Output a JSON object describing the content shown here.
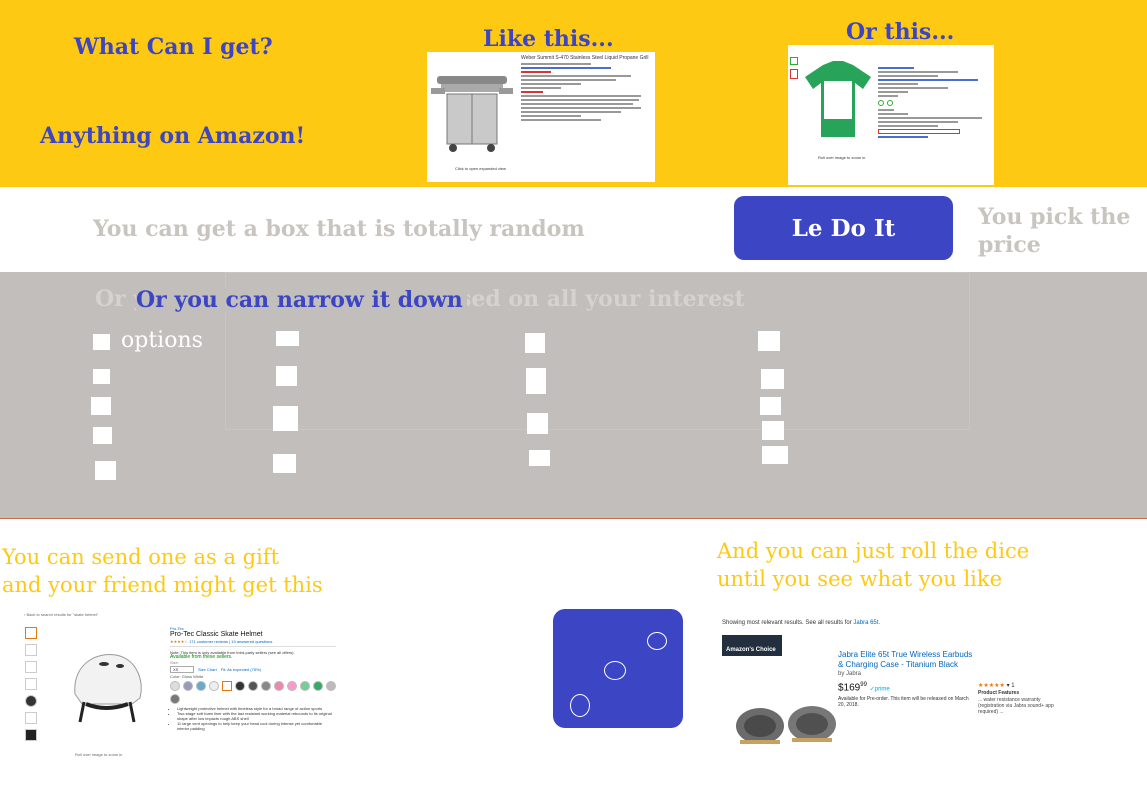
{
  "header": {
    "question": "What Can I get?",
    "answer": "Anything on Amazon!",
    "example1_caption": "Like this...",
    "example2_caption": "Or this..."
  },
  "grill_listing": {
    "title": "Weber Summit S-470 Stainless Steel Liquid Propane Grill",
    "caption": "Click to open expanded view"
  },
  "shirt_listing": {
    "caption": "Roll over image to zoom in"
  },
  "random_row": {
    "text": "You can get a box that is totally random",
    "button_label": "Le Do It",
    "price_text": "You pick the price"
  },
  "narrow_section": {
    "heading": "Or you can narrow it down",
    "ghost_heading": "Or you can narrow it down based on all your interest",
    "options_label": "options"
  },
  "gift": {
    "line1": "You can send one as a gift",
    "line2": "and your friend might get this"
  },
  "dice_section": {
    "line1": "And you can just roll the dice",
    "line2": "until you see what you like"
  },
  "helmet_listing": {
    "back_link": "‹ Back to search results for \"skate helmet\"",
    "brand": "Pro-Tec",
    "title": "Pro-Tec Classic Skate Helmet",
    "reviews": "171 customer reviews",
    "questions": "19 answered questions",
    "note": "Note: This item is only available from third-party sellers (see all offers).",
    "availability": "Available from these sellers.",
    "size_label": "Size:",
    "size_value": "XS",
    "size_chart": "Size Chart",
    "fit_text": "Fit: As expected (75%)",
    "color_label": "Color: Gloss White",
    "bullets": [
      "Lightweight protective helmet with timeless style for a broad range of action sports",
      "Two-stage soft foam liner with the last resistant working material rebounds to its original shape after low impacts rough ABS shell",
      "11 large vent openings to help keep your head cool during intense yet comfortable interior padding"
    ],
    "zoom_caption": "Roll over image to zoom in"
  },
  "earbuds_listing": {
    "results_text": "Showing most relevant results. See all results for",
    "results_query": "Jabra 65t.",
    "badge": "Amazon's Choice",
    "title": "Jabra Elite 65t True Wireless Earbuds & Charging Case - Titanium Black",
    "by": "by Jabra",
    "price": "$169",
    "price_cents": "99",
    "prime": "✓prime",
    "preorder": "Available for Pre-order. This item will be released on March 20, 2018.",
    "rating_count": "1",
    "features_label": "Product Features",
    "features": "... water resistance warranty (registration via Jabra sound+ app required) ..."
  },
  "colors": {
    "yellow": "#fec913",
    "blue": "#3c45c4",
    "gray_band": "#c1bebb",
    "light_text": "#c8c4bf"
  }
}
